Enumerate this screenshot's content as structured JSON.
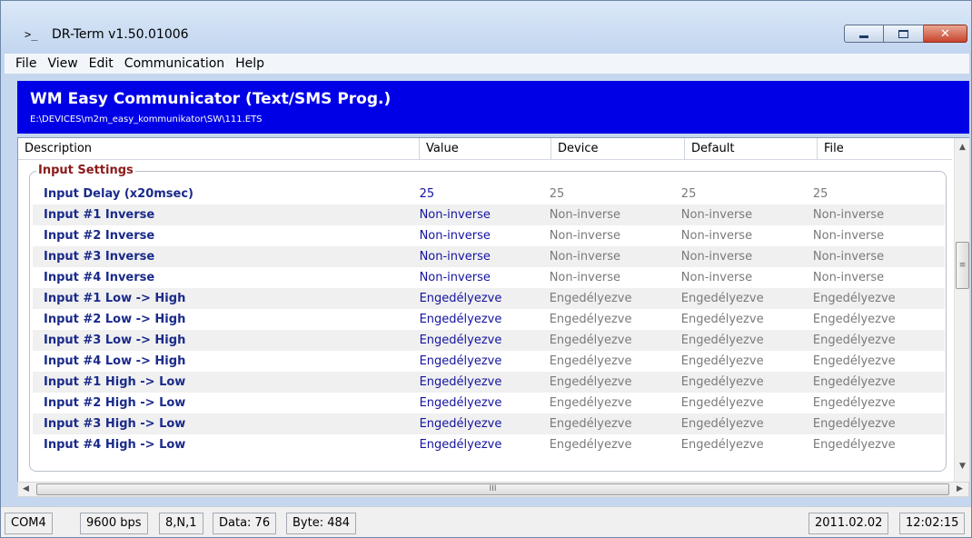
{
  "window": {
    "icon": ">_",
    "title": "DR-Term  v1.50.01006",
    "min_icon": "minimize-icon",
    "max_icon": "maximize-icon",
    "close_icon": "close-icon",
    "close_color": "#c8442c"
  },
  "menu": [
    {
      "label": "File"
    },
    {
      "label": "View"
    },
    {
      "label": "Edit"
    },
    {
      "label": "Communication"
    },
    {
      "label": "Help"
    }
  ],
  "banner": {
    "title": "WM Easy Communicator (Text/SMS Prog.)",
    "path": "E:\\DEVICES\\m2m_easy_kommunikator\\SW\\111.ETS",
    "background": "#0000e6"
  },
  "columns": {
    "description": "Description",
    "value": "Value",
    "device": "Device",
    "default": "Default",
    "file": "File"
  },
  "group": {
    "title": "Input Settings",
    "title_color": "#8b1a1a"
  },
  "rows": [
    {
      "desc": "Input Delay (x20msec)",
      "value": "25",
      "device": "25",
      "default": "25",
      "file": "25"
    },
    {
      "desc": "Input #1 Inverse",
      "value": "Non-inverse",
      "device": "Non-inverse",
      "default": "Non-inverse",
      "file": "Non-inverse"
    },
    {
      "desc": "Input #2 Inverse",
      "value": "Non-inverse",
      "device": "Non-inverse",
      "default": "Non-inverse",
      "file": "Non-inverse"
    },
    {
      "desc": "Input #3 Inverse",
      "value": "Non-inverse",
      "device": "Non-inverse",
      "default": "Non-inverse",
      "file": "Non-inverse"
    },
    {
      "desc": "Input #4 Inverse",
      "value": "Non-inverse",
      "device": "Non-inverse",
      "default": "Non-inverse",
      "file": "Non-inverse"
    },
    {
      "desc": "Input #1 Low -> High",
      "value": "Engedélyezve",
      "device": "Engedélyezve",
      "default": "Engedélyezve",
      "file": "Engedélyezve"
    },
    {
      "desc": "Input #2 Low -> High",
      "value": "Engedélyezve",
      "device": "Engedélyezve",
      "default": "Engedélyezve",
      "file": "Engedélyezve"
    },
    {
      "desc": "Input #3 Low -> High",
      "value": "Engedélyezve",
      "device": "Engedélyezve",
      "default": "Engedélyezve",
      "file": "Engedélyezve"
    },
    {
      "desc": "Input #4 Low -> High",
      "value": "Engedélyezve",
      "device": "Engedélyezve",
      "default": "Engedélyezve",
      "file": "Engedélyezve"
    },
    {
      "desc": "Input #1 High -> Low",
      "value": "Engedélyezve",
      "device": "Engedélyezve",
      "default": "Engedélyezve",
      "file": "Engedélyezve"
    },
    {
      "desc": "Input #2 High -> Low",
      "value": "Engedélyezve",
      "device": "Engedélyezve",
      "default": "Engedélyezve",
      "file": "Engedélyezve"
    },
    {
      "desc": "Input #3 High -> Low",
      "value": "Engedélyezve",
      "device": "Engedélyezve",
      "default": "Engedélyezve",
      "file": "Engedélyezve"
    },
    {
      "desc": "Input #4 High -> Low",
      "value": "Engedélyezve",
      "device": "Engedélyezve",
      "default": "Engedélyezve",
      "file": "Engedélyezve"
    }
  ],
  "scrollbars": {
    "up_icon": "scroll-up-icon",
    "down_icon": "scroll-down-icon",
    "left_icon": "scroll-left-icon",
    "right_icon": "scroll-right-icon",
    "grip_glyph": "III"
  },
  "status": {
    "port": "COM4",
    "baud": "9600 bps",
    "frame": "8,N,1",
    "data": "Data: 76",
    "byte": "Byte: 484",
    "date": "2011.02.02",
    "time": "12:02:15"
  }
}
